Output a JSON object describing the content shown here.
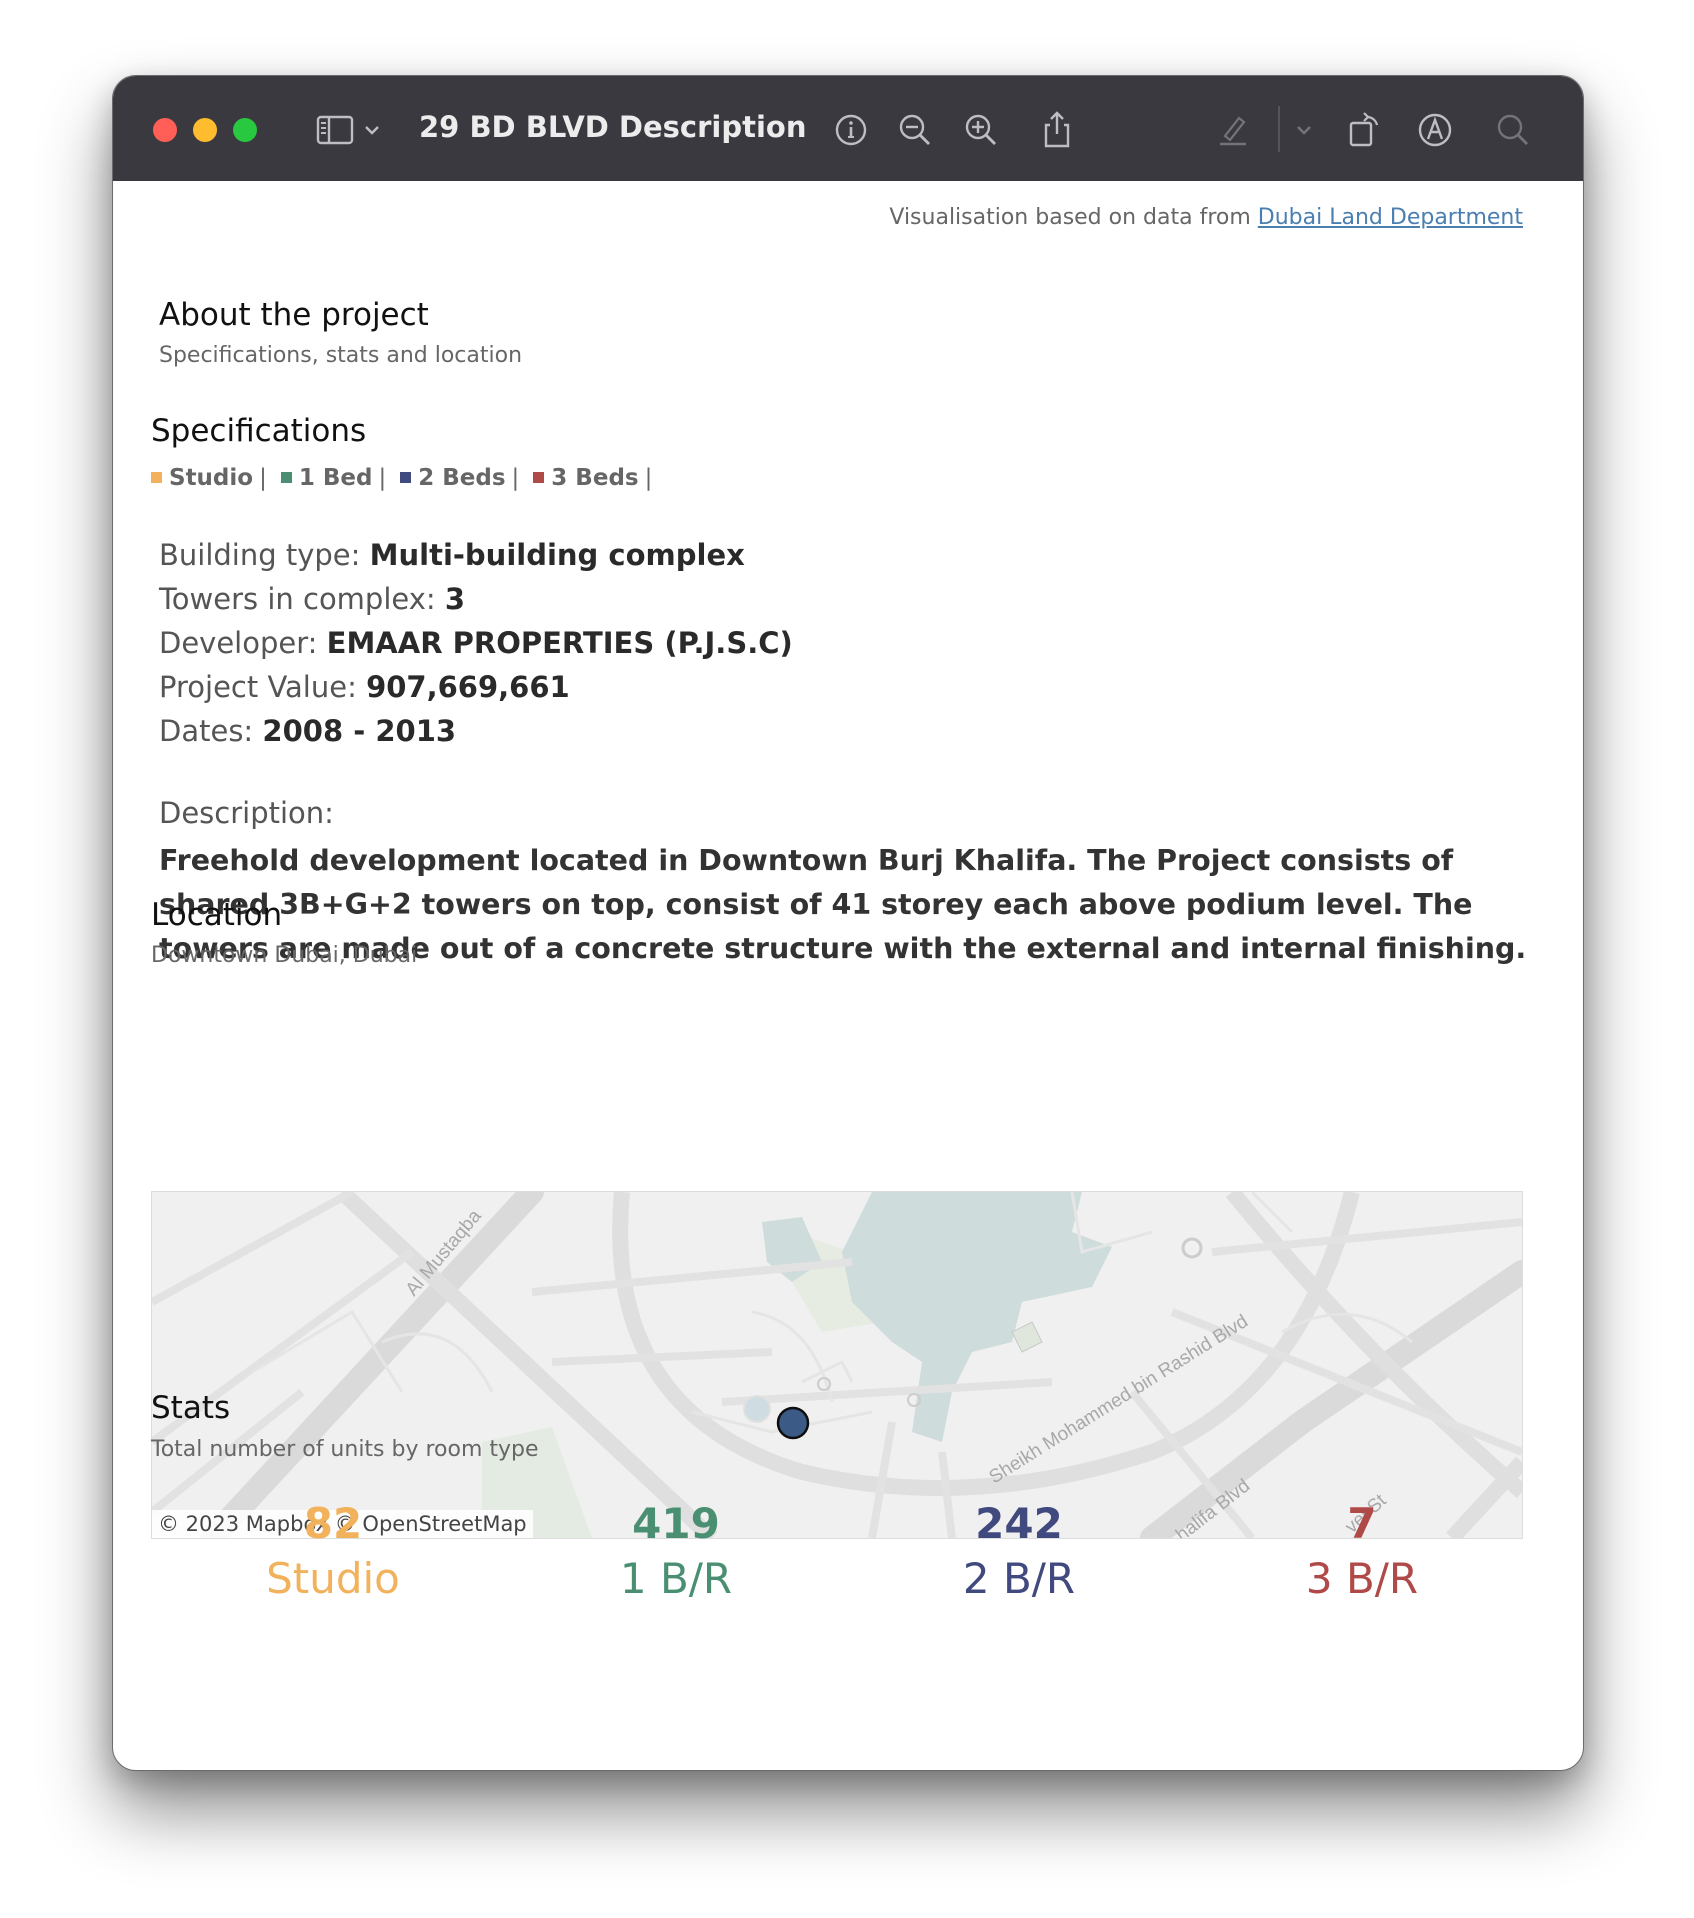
{
  "window": {
    "title": "29 BD BLVD Description",
    "toolbar_icons": [
      "sidebar-icon",
      "chevron-down-icon",
      "info-icon",
      "zoom-out-icon",
      "zoom-in-icon",
      "share-icon",
      "highlight-pen-icon",
      "chevron-down-icon",
      "rotate-icon",
      "markup-icon",
      "search-icon"
    ]
  },
  "attribution": {
    "prefix": "Visualisation based on data from",
    "link": "Dubai Land Department"
  },
  "about": {
    "title": "About the project",
    "subtitle": "Specifications, stats and location"
  },
  "specifications": {
    "title": "Specifications",
    "legend": [
      {
        "label": "Studio",
        "color": "#f2b25c"
      },
      {
        "label": "1 Bed",
        "color": "#4b8f72"
      },
      {
        "label": "2 Beds",
        "color": "#414a7e"
      },
      {
        "label": "3 Beds",
        "color": "#b04a48"
      }
    ],
    "building_type_label": "Building type:",
    "building_type": "Multi-building complex",
    "towers_label": "Towers in complex:",
    "towers": "3",
    "developer_label": "Developer:",
    "developer": "EMAAR PROPERTIES (P.J.S.C)",
    "value_label": "Project Value:",
    "value": "907,669,661",
    "dates_label": "Dates:",
    "dates": "2008 - 2013",
    "description_label": "Description:",
    "description": "Freehold development located in Downtown Burj Khalifa. The Project consists of shared 3B+G+2 towers on top, consist of 41 storey each above podium level. The towers are made out of a concrete structure with the external and internal finishing."
  },
  "location": {
    "title": "Location",
    "subtitle": "Downtown Dubai, Dubai",
    "map": {
      "attribution": "© 2023 Mapbox  © OpenStreetMap",
      "road_labels": [
        "Al Mustaqba",
        "Sheikh Mohammed bin Rashid Blvd",
        "halifa Blvd",
        "vel St"
      ],
      "marker_color": "#3b5a85"
    }
  },
  "stats": {
    "title": "Stats",
    "subtitle": "Total number of units by room type",
    "items": [
      {
        "value": "82",
        "label": "Studio",
        "color": "#f2b25c"
      },
      {
        "value": "419",
        "label": "1 B/R",
        "color": "#4b8f72"
      },
      {
        "value": "242",
        "label": "2 B/R",
        "color": "#414a7e"
      },
      {
        "value": "7",
        "label": "3 B/R",
        "color": "#b04a48"
      }
    ]
  }
}
